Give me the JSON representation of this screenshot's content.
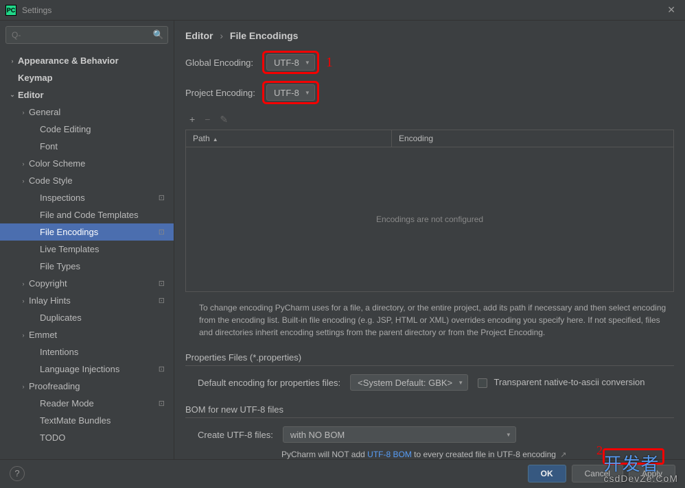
{
  "window": {
    "title": "Settings"
  },
  "search": {
    "placeholder": "Q-"
  },
  "breadcrumb": {
    "root": "Editor",
    "leaf": "File Encodings"
  },
  "sidebar": {
    "items": [
      {
        "label": "Appearance & Behavior",
        "indent": 0,
        "bold": true,
        "chevron": "›"
      },
      {
        "label": "Keymap",
        "indent": 0,
        "bold": true,
        "chevron": ""
      },
      {
        "label": "Editor",
        "indent": 0,
        "bold": true,
        "chevron": "v"
      },
      {
        "label": "General",
        "indent": 1,
        "chevron": "›"
      },
      {
        "label": "Code Editing",
        "indent": 2,
        "chevron": ""
      },
      {
        "label": "Font",
        "indent": 2,
        "chevron": ""
      },
      {
        "label": "Color Scheme",
        "indent": 1,
        "chevron": "›"
      },
      {
        "label": "Code Style",
        "indent": 1,
        "chevron": "›"
      },
      {
        "label": "Inspections",
        "indent": 2,
        "chevron": "",
        "badge": "⊡"
      },
      {
        "label": "File and Code Templates",
        "indent": 2,
        "chevron": ""
      },
      {
        "label": "File Encodings",
        "indent": 2,
        "chevron": "",
        "badge": "⊡",
        "selected": true
      },
      {
        "label": "Live Templates",
        "indent": 2,
        "chevron": ""
      },
      {
        "label": "File Types",
        "indent": 2,
        "chevron": ""
      },
      {
        "label": "Copyright",
        "indent": 1,
        "chevron": "›",
        "badge": "⊡"
      },
      {
        "label": "Inlay Hints",
        "indent": 1,
        "chevron": "›",
        "badge": "⊡"
      },
      {
        "label": "Duplicates",
        "indent": 2,
        "chevron": ""
      },
      {
        "label": "Emmet",
        "indent": 1,
        "chevron": "›"
      },
      {
        "label": "Intentions",
        "indent": 2,
        "chevron": ""
      },
      {
        "label": "Language Injections",
        "indent": 2,
        "chevron": "",
        "badge": "⊡"
      },
      {
        "label": "Proofreading",
        "indent": 1,
        "chevron": "›"
      },
      {
        "label": "Reader Mode",
        "indent": 2,
        "chevron": "",
        "badge": "⊡"
      },
      {
        "label": "TextMate Bundles",
        "indent": 2,
        "chevron": ""
      },
      {
        "label": "TODO",
        "indent": 2,
        "chevron": ""
      }
    ]
  },
  "form": {
    "global_encoding_label": "Global Encoding:",
    "global_encoding_value": "UTF-8",
    "project_encoding_label": "Project Encoding:",
    "project_encoding_value": "UTF-8",
    "annotation_1": "1"
  },
  "table": {
    "col1": "Path",
    "col2": "Encoding",
    "empty_text": "Encodings are not configured"
  },
  "help_text": "To change encoding PyCharm uses for a file, a directory, or the entire project, add its path if necessary and then select encoding from the encoding list. Built-in file encoding (e.g. JSP, HTML or XML) overrides encoding you specify here. If not specified, files and directories inherit encoding settings from the parent directory or from the Project Encoding.",
  "properties": {
    "section": "Properties Files (*.properties)",
    "label": "Default encoding for properties files:",
    "value": "<System Default: GBK>",
    "checkbox_label": "Transparent native-to-ascii conversion"
  },
  "bom": {
    "section": "BOM for new UTF-8 files",
    "label": "Create UTF-8 files:",
    "value": "with NO BOM",
    "note_pre": "PyCharm will NOT add ",
    "note_link": "UTF-8 BOM",
    "note_post": " to every created file in UTF-8 encoding"
  },
  "footer": {
    "ok": "OK",
    "cancel": "Cancel",
    "apply": "Apply"
  },
  "watermark": {
    "big": "开发者",
    "small": "csdDevZe.CoM"
  },
  "annotation_2": "2"
}
